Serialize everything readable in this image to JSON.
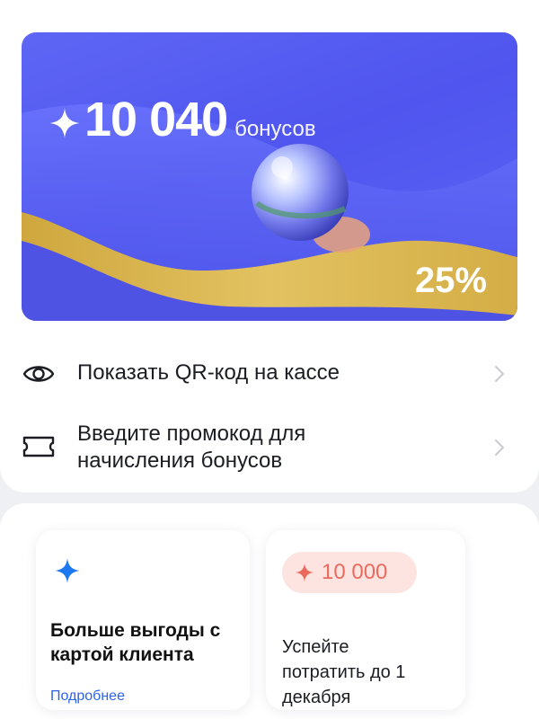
{
  "bonus_card": {
    "amount": "10 040",
    "unit": "бонусов",
    "percent": "25%"
  },
  "menu": {
    "qr_label": "Показать QR-код на кассе",
    "promo_line1": "Введите промокод для",
    "promo_line2": "начисления бонусов"
  },
  "cards": {
    "client_card": {
      "title_line1": "Больше выгоды с",
      "title_line2": "картой клиента",
      "link": "Подробнее"
    },
    "expiring": {
      "amount": "10 000",
      "line1": "Успейте",
      "line2": "потратить до 1",
      "line3": "декабря"
    }
  },
  "colors": {
    "card_blue": "#5058ef",
    "gold": "#d7b14a",
    "link_blue": "#2c63e6",
    "accent_coral": "#ea6b5e",
    "pill_bg": "#fde4e1",
    "star_blue": "#1e78f0"
  },
  "icons": [
    "sparkle-icon",
    "eye-icon",
    "ticket-icon",
    "chevron-right-icon",
    "star-icon"
  ]
}
